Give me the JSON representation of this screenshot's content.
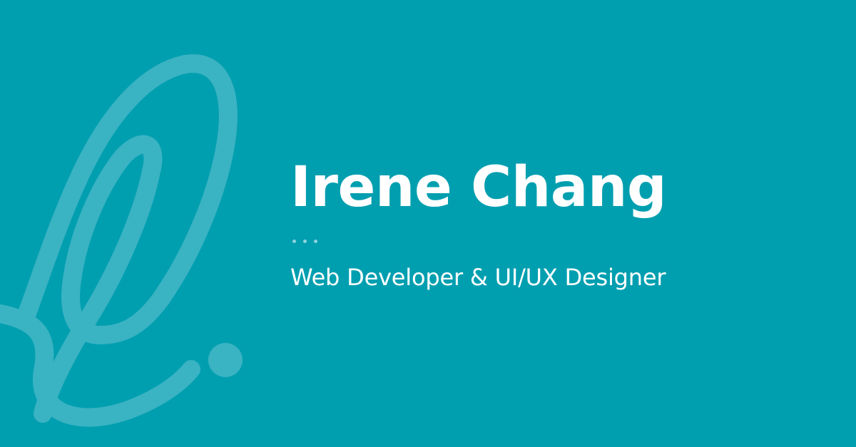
{
  "card": {
    "name": "Irene Chang",
    "tagline": "Web Developer & UI/UX Designer",
    "decorative_dots": 3
  },
  "logo": {
    "icon": "script-letter-i-monogram-icon"
  },
  "colors": {
    "background": "#009fb0",
    "logo": "#3ab3c3",
    "text": "#ffffff",
    "dots": "#8fd3dc"
  }
}
